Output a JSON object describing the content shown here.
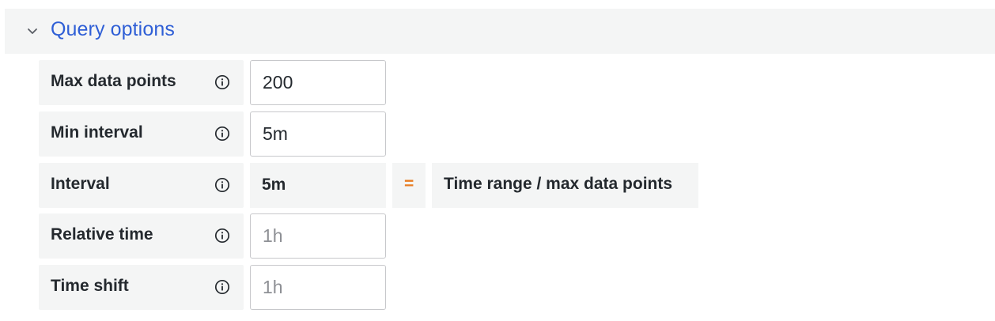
{
  "section": {
    "title": "Query options",
    "expanded": true
  },
  "rows": [
    {
      "label": "Max data points",
      "value": "200",
      "kind": "input"
    },
    {
      "label": "Min interval",
      "value": "5m",
      "kind": "input"
    },
    {
      "label": "Interval",
      "value": "5m",
      "kind": "static",
      "operator": "=",
      "formula": "Time range / max data points"
    },
    {
      "label": "Relative time",
      "placeholder": "1h",
      "kind": "input"
    },
    {
      "label": "Time shift",
      "placeholder": "1h",
      "kind": "input"
    }
  ],
  "colors": {
    "accent": "#2f5fd6",
    "operator": "#e87d24",
    "panel_bg": "#f4f5f5"
  },
  "icons": {
    "collapse": "chevron-down-icon",
    "info": "info-circle-icon"
  }
}
